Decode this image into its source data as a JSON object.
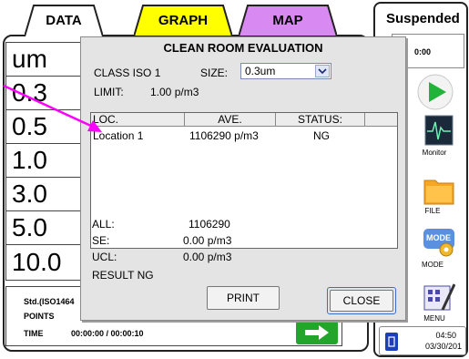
{
  "tabs": [
    {
      "label": "DATA",
      "color": "#ffffff"
    },
    {
      "label": "GRAPH",
      "color": "#ffff00"
    },
    {
      "label": "MAP",
      "color": "#d889f2"
    }
  ],
  "values": [
    "um",
    "0.3",
    "0.5",
    "1.0",
    "3.0",
    "5.0",
    "10.0"
  ],
  "info": {
    "std_label": "Std.(ISO1464",
    "points_label": "POINTS",
    "time_label": "TIME",
    "time_value": "00:00:00 / 00:00:10"
  },
  "status": {
    "label": "Suspended",
    "time_partial": "0:00"
  },
  "side_buttons": [
    {
      "label": "Monitor"
    },
    {
      "label": "FILE"
    },
    {
      "label": "MODE"
    },
    {
      "label": "MENU"
    }
  ],
  "clock": {
    "time": "04:50",
    "date": "03/30/201"
  },
  "dialog": {
    "title": "CLEAN ROOM EVALUATION",
    "class_label": "CLASS ISO 1",
    "size_label": "SIZE:",
    "size_value": "0.3um",
    "limit_label": "LIMIT:",
    "limit_value": "1.00 p/m3",
    "columns": [
      "LOC.",
      "AVE.",
      "STATUS:"
    ],
    "rows": [
      {
        "loc": "Location 1",
        "ave": "1106290 p/m3",
        "status": "NG"
      }
    ],
    "summary": [
      {
        "label": "ALL:",
        "value": "1106290"
      },
      {
        "label": "SE:",
        "value": "0.00 p/m3"
      },
      {
        "label": "UCL:",
        "value": "0.00 p/m3"
      }
    ],
    "result": "RESULT NG",
    "print_label": "PRINT",
    "close_label": "CLOSE"
  },
  "colors": {
    "accent_arrow": "#ff00ff",
    "play_green": "#22b43a",
    "go_green": "#22a52a",
    "select_border": "#7a8ab0",
    "close_focus": "#3c6ec8"
  }
}
